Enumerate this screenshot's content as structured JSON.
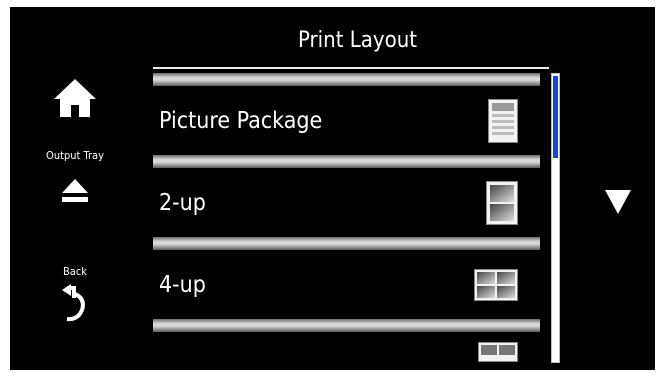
{
  "header": {
    "title": "Print Layout"
  },
  "nav": {
    "home": {
      "icon": "home-icon"
    },
    "output_tray": {
      "label": "Output Tray",
      "icon": "eject-icon"
    },
    "back": {
      "label": "Back",
      "icon": "back-arrow-icon"
    }
  },
  "list": {
    "items": [
      {
        "label": "Picture Package",
        "icon": "picture-package-icon"
      },
      {
        "label": "2-up",
        "icon": "two-up-icon"
      },
      {
        "label": "4-up",
        "icon": "four-up-icon"
      }
    ]
  },
  "scroll": {
    "down_icon": "down-arrow-icon"
  },
  "colors": {
    "background": "#000000",
    "text": "#ffffff",
    "scroll_thumb": "#1a44d9"
  }
}
